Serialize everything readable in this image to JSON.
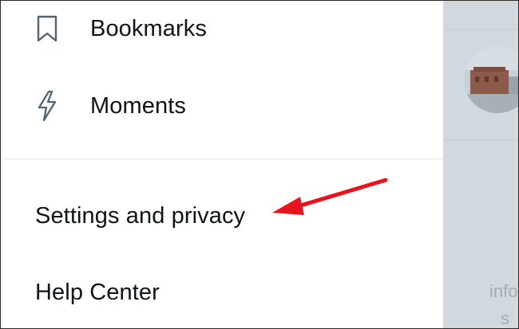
{
  "drawer": {
    "items": [
      {
        "label": "Bookmarks",
        "icon": "bookmark-icon"
      },
      {
        "label": "Moments",
        "icon": "lightning-icon"
      },
      {
        "label": "Settings and privacy"
      },
      {
        "label": "Help Center"
      }
    ]
  },
  "backdrop": {
    "faded_text_1": "info",
    "faded_text_2": "s"
  },
  "colors": {
    "text": "#0f1419",
    "icon_stroke": "#536471",
    "divider": "#e1e6ea",
    "backdrop": "#d2d9de",
    "annotation_arrow": "#e8141b"
  }
}
